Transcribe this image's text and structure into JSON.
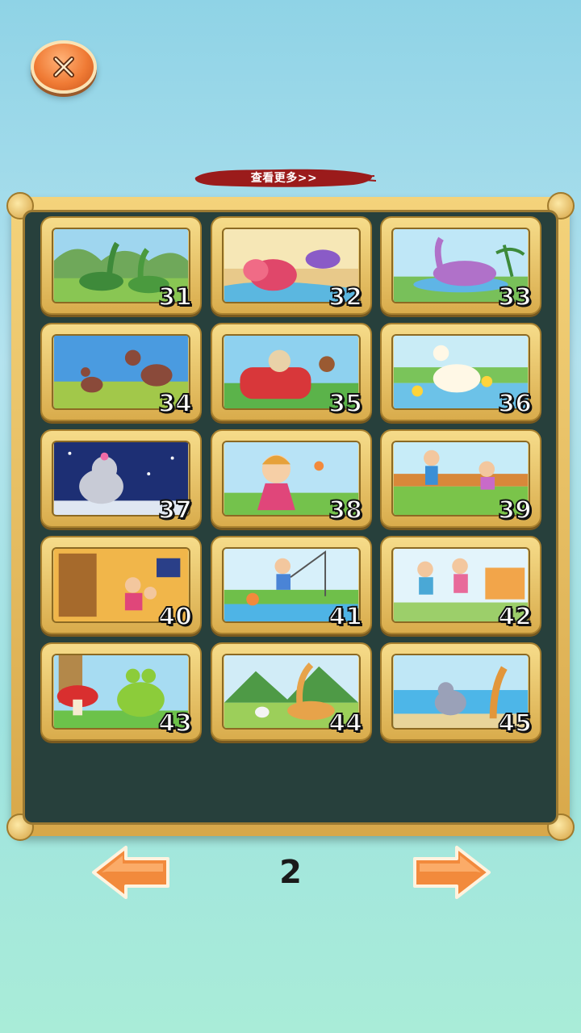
{
  "header": {
    "close_icon": "close-icon"
  },
  "banner": {
    "more_label": "查看更多>>"
  },
  "puzzles": [
    {
      "number": "31",
      "theme": "dinosaurs"
    },
    {
      "number": "32",
      "theme": "triceratops"
    },
    {
      "number": "33",
      "theme": "purple-dinosaur"
    },
    {
      "number": "34",
      "theme": "dodo-birds"
    },
    {
      "number": "35",
      "theme": "dog-car"
    },
    {
      "number": "36",
      "theme": "duck-pond"
    },
    {
      "number": "37",
      "theme": "elephant-night"
    },
    {
      "number": "38",
      "theme": "girl-flowers"
    },
    {
      "number": "39",
      "theme": "kids-park"
    },
    {
      "number": "40",
      "theme": "kids-room"
    },
    {
      "number": "41",
      "theme": "boy-fishing"
    },
    {
      "number": "42",
      "theme": "kids-school"
    },
    {
      "number": "43",
      "theme": "frog-mushroom"
    },
    {
      "number": "44",
      "theme": "giraffe-rabbit"
    },
    {
      "number": "45",
      "theme": "elephant-giraffe"
    }
  ],
  "pagination": {
    "current_page": "2",
    "prev_icon": "arrow-left-icon",
    "next_icon": "arrow-right-icon"
  },
  "colors": {
    "board_dark": "#27403c",
    "frame_gold": "#e6bf62",
    "arrow_orange": "#f28a3c",
    "close_orange": "#f07b35"
  }
}
